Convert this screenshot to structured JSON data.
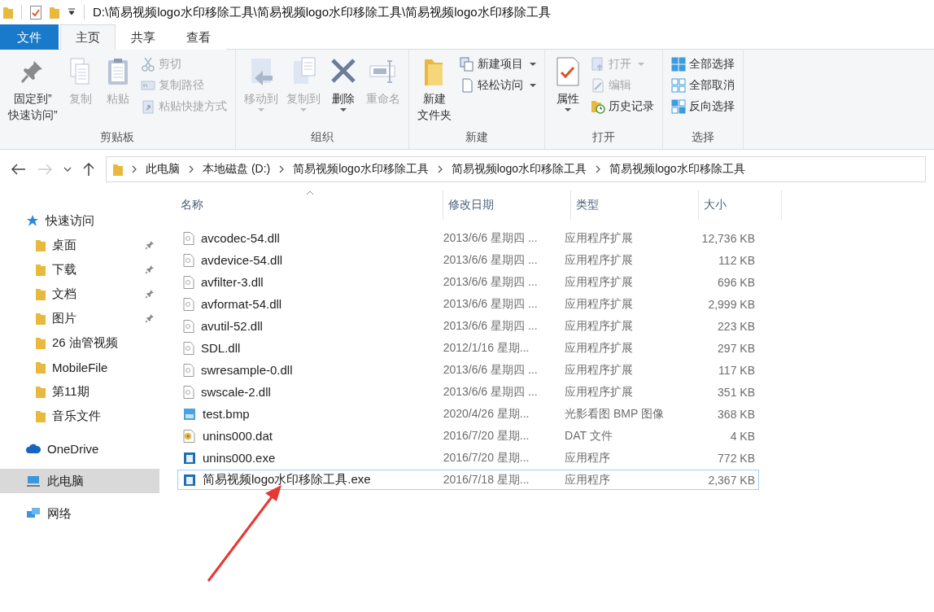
{
  "title_bar": {
    "path": "D:\\简易视频logo水印移除工具\\简易视频logo水印移除工具\\简易视频logo水印移除工具"
  },
  "ribbon_tabs": [
    {
      "label": "文件",
      "kind": "file",
      "selected": false
    },
    {
      "label": "主页",
      "kind": "tab",
      "selected": true
    },
    {
      "label": "共享",
      "kind": "tab",
      "selected": false
    },
    {
      "label": "查看",
      "kind": "tab",
      "selected": false
    }
  ],
  "ribbon_groups": [
    {
      "label": "剪贴板",
      "items": [
        {
          "kind": "large",
          "label": [
            "固定到”",
            "快速访问”"
          ],
          "disabled": false,
          "dropdown": false
        },
        {
          "kind": "large",
          "label": "复制",
          "disabled": true,
          "dropdown": false
        },
        {
          "kind": "large",
          "label": "粘贴",
          "disabled": true,
          "dropdown": false
        },
        {
          "kind": "small",
          "label": "剪切",
          "disabled": true,
          "dropdown": false
        },
        {
          "kind": "small",
          "label": "复制路径",
          "disabled": true,
          "dropdown": false
        },
        {
          "kind": "small",
          "label": "粘贴快捷方式",
          "disabled": true,
          "dropdown": false
        }
      ]
    },
    {
      "label": "组织",
      "items": [
        {
          "kind": "large",
          "label": "移动到",
          "disabled": true,
          "dropdown": true
        },
        {
          "kind": "large",
          "label": "复制到",
          "disabled": true,
          "dropdown": true
        },
        {
          "kind": "large",
          "label": "删除",
          "disabled": false,
          "dropdown": true
        },
        {
          "kind": "large",
          "label": "重命名",
          "disabled": true,
          "dropdown": false
        }
      ]
    },
    {
      "label": "新建",
      "items": [
        {
          "kind": "large",
          "label": [
            "新建",
            "文件夹"
          ],
          "disabled": false,
          "dropdown": false
        },
        {
          "kind": "small",
          "label": "新建项目",
          "disabled": false,
          "dropdown": true
        },
        {
          "kind": "small",
          "label": "轻松访问",
          "disabled": false,
          "dropdown": true
        }
      ]
    },
    {
      "label": "打开",
      "items": [
        {
          "kind": "large",
          "label": "属性",
          "disabled": false,
          "dropdown": true
        },
        {
          "kind": "small",
          "label": "打开",
          "disabled": true,
          "dropdown": true
        },
        {
          "kind": "small",
          "label": "编辑",
          "disabled": true,
          "dropdown": false
        },
        {
          "kind": "small",
          "label": "历史记录",
          "disabled": false,
          "dropdown": false
        }
      ]
    },
    {
      "label": "选择",
      "items": [
        {
          "kind": "small",
          "label": "全部选择",
          "disabled": false,
          "dropdown": false
        },
        {
          "kind": "small",
          "label": "全部取消",
          "disabled": false,
          "dropdown": false
        },
        {
          "kind": "small",
          "label": "反向选择",
          "disabled": false,
          "dropdown": false
        }
      ]
    }
  ],
  "navigation": {
    "back_disabled": false,
    "forward_disabled": true
  },
  "breadcrumb": [
    "此电脑",
    "本地磁盘 (D:)",
    "简易视频logo水印移除工具",
    "简易视频logo水印移除工具",
    "简易视频logo水印移除工具"
  ],
  "sidebar": {
    "items": [
      {
        "label": "快速访问",
        "kind": "star",
        "selected": false,
        "pinned": false,
        "children": [
          {
            "label": "桌面",
            "kind": "folder",
            "selected": false,
            "pinned": true
          },
          {
            "label": "下载",
            "kind": "folder",
            "selected": false,
            "pinned": true
          },
          {
            "label": "文档",
            "kind": "folder",
            "selected": false,
            "pinned": true
          },
          {
            "label": "图片",
            "kind": "folder",
            "selected": false,
            "pinned": true
          },
          {
            "label": "26 油管视频",
            "kind": "folder",
            "selected": false,
            "pinned": false
          },
          {
            "label": "MobileFile",
            "kind": "folder",
            "selected": false,
            "pinned": false
          },
          {
            "label": "第11期",
            "kind": "folder",
            "selected": false,
            "pinned": false
          },
          {
            "label": "音乐文件",
            "kind": "folder",
            "selected": false,
            "pinned": false
          }
        ]
      },
      {
        "label": "OneDrive",
        "kind": "cloud",
        "selected": false,
        "pinned": false
      },
      {
        "label": "此电脑",
        "kind": "pc",
        "selected": true,
        "pinned": false
      },
      {
        "label": "网络",
        "kind": "network",
        "selected": false,
        "pinned": false
      }
    ]
  },
  "table": {
    "columns": [
      {
        "label": "名称",
        "sorted": true
      },
      {
        "label": "修改日期",
        "sorted": false
      },
      {
        "label": "类型",
        "sorted": false
      },
      {
        "label": "大小",
        "sorted": false
      }
    ],
    "rows": [
      {
        "kind": "dll",
        "name": "avcodec-54.dll",
        "date": "2013/6/6 星期四 ...",
        "type": "应用程序扩展",
        "size": "12,736 KB",
        "selected": false
      },
      {
        "kind": "dll",
        "name": "avdevice-54.dll",
        "date": "2013/6/6 星期四 ...",
        "type": "应用程序扩展",
        "size": "112 KB",
        "selected": false
      },
      {
        "kind": "dll",
        "name": "avfilter-3.dll",
        "date": "2013/6/6 星期四 ...",
        "type": "应用程序扩展",
        "size": "696 KB",
        "selected": false
      },
      {
        "kind": "dll",
        "name": "avformat-54.dll",
        "date": "2013/6/6 星期四 ...",
        "type": "应用程序扩展",
        "size": "2,999 KB",
        "selected": false
      },
      {
        "kind": "dll",
        "name": "avutil-52.dll",
        "date": "2013/6/6 星期四 ...",
        "type": "应用程序扩展",
        "size": "223 KB",
        "selected": false
      },
      {
        "kind": "dll",
        "name": "SDL.dll",
        "date": "2012/1/16 星期...",
        "type": "应用程序扩展",
        "size": "297 KB",
        "selected": false
      },
      {
        "kind": "dll",
        "name": "swresample-0.dll",
        "date": "2013/6/6 星期四 ...",
        "type": "应用程序扩展",
        "size": "117 KB",
        "selected": false
      },
      {
        "kind": "dll",
        "name": "swscale-2.dll",
        "date": "2013/6/6 星期四 ...",
        "type": "应用程序扩展",
        "size": "351 KB",
        "selected": false
      },
      {
        "kind": "image",
        "name": "test.bmp",
        "date": "2020/4/26 星期...",
        "type": "光影看图 BMP 图像",
        "size": "368 KB",
        "selected": false
      },
      {
        "kind": "media",
        "name": "unins000.dat",
        "date": "2016/7/20 星期...",
        "type": "DAT 文件",
        "size": "4 KB",
        "selected": false
      },
      {
        "kind": "app",
        "name": "unins000.exe",
        "date": "2016/7/20 星期...",
        "type": "应用程序",
        "size": "772 KB",
        "selected": false
      },
      {
        "kind": "app",
        "name": "简易视频logo水印移除工具.exe",
        "date": "2016/7/18 星期...",
        "type": "应用程序",
        "size": "2,367 KB",
        "selected": true
      }
    ]
  }
}
